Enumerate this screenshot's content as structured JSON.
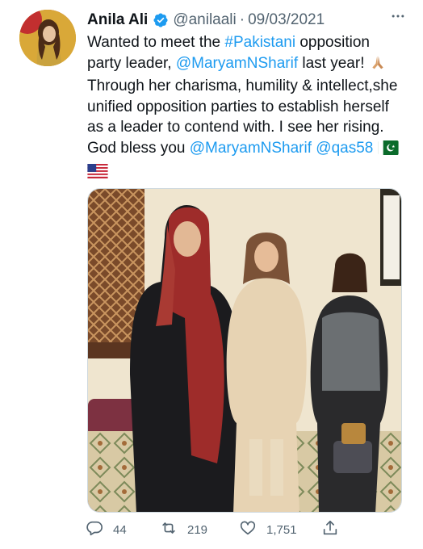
{
  "tweet": {
    "author": {
      "display_name": "Anila Ali",
      "handle": "@anilaali",
      "verified": true,
      "avatar_icon": "profile-photo"
    },
    "separator": "·",
    "date": "09/03/2021",
    "more_icon": "more-horizontal-icon",
    "text_segments": [
      {
        "text": "Wanted to meet the ",
        "type": "text"
      },
      {
        "text": "#Pakistani",
        "type": "hashtag"
      },
      {
        "text": " opposition party leader, ",
        "type": "text"
      },
      {
        "text": "@MaryamNSharif",
        "type": "mention"
      },
      {
        "text": " last year! ",
        "type": "text"
      },
      {
        "text": "🙏",
        "type": "emoji"
      },
      {
        "text": "Through her charisma, humility & intellect,she unified opposition parties to establish herself as a leader to contend with. I see her rising. God bless you ",
        "type": "text"
      },
      {
        "text": "@MaryamNSharif",
        "type": "mention"
      },
      {
        "text": " ",
        "type": "text"
      },
      {
        "text": "@qas58",
        "type": "mention"
      },
      {
        "text": " ",
        "type": "text"
      },
      {
        "text": "🇵🇰",
        "type": "flag"
      },
      {
        "text": " ",
        "type": "text"
      },
      {
        "text": "🇺🇸",
        "type": "flag"
      }
    ],
    "media": {
      "type": "photo",
      "description_icon": "group-photo"
    },
    "actions": {
      "reply": {
        "icon": "reply-icon",
        "count": "44"
      },
      "retweet": {
        "icon": "retweet-icon",
        "count": "219"
      },
      "like": {
        "icon": "heart-icon",
        "count": "1,751"
      },
      "share": {
        "icon": "share-icon"
      }
    },
    "colors": {
      "link": "#1d9bf0",
      "text": "#0f1419",
      "muted": "#536471",
      "verified": "#1d9bf0"
    }
  }
}
